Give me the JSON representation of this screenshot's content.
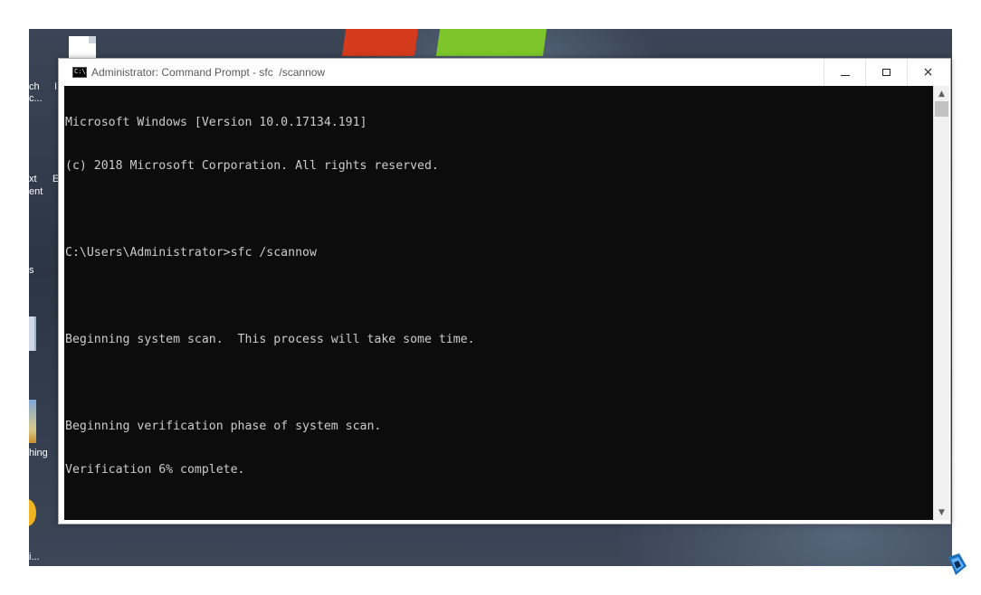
{
  "window": {
    "title": "Administrator: Command Prompt - sfc  /scannow",
    "icon_text": "C:\\."
  },
  "controls": {
    "minimize": "minimize",
    "maximize": "maximize",
    "close": "×"
  },
  "console": {
    "lines": [
      "Microsoft Windows [Version 10.0.17134.191]",
      "(c) 2018 Microsoft Corporation. All rights reserved.",
      "",
      "C:\\Users\\Administrator>sfc /scannow",
      "",
      "Beginning system scan.  This process will take some time.",
      "",
      "Beginning verification phase of system scan.",
      "Verification 6% complete."
    ],
    "background": "#0c0c0c",
    "foreground": "#cccccc"
  },
  "scrollbar": {
    "up_arrow": "▲",
    "down_arrow": "▼"
  },
  "desktop": {
    "labels": [
      "ch",
      "c...",
      "xt",
      "ent",
      "s",
      "hing",
      "i..."
    ],
    "side_letters": [
      "I",
      "E"
    ]
  },
  "icons": {
    "app": "cmd-icon",
    "tray": "app-tray-icon"
  }
}
